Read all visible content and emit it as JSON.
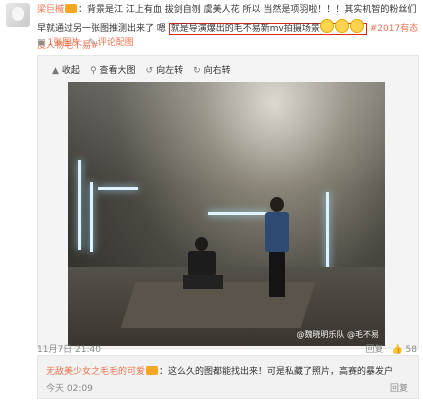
{
  "post": {
    "author": "梁巨槭",
    "text_part1": "：背景是江 江上有血 拔剑自刎 虞美人花 所以 当然是项羽啦！！！其实机智的粉丝们早就通过另一张图推测出来了 嗯",
    "text_boxed": "就是导演爆出的毛不易新mv拍摄场景",
    "topic": "#2017有态度人物毛不易#",
    "links": [
      {
        "icon": "image-icon",
        "label": "1张图片"
      },
      {
        "icon": "comment-icon",
        "label": "评论配图"
      }
    ]
  },
  "viewer": {
    "toolbar": [
      {
        "icon": "collapse-icon",
        "label": "收起"
      },
      {
        "icon": "zoom-icon",
        "label": "查看大图"
      },
      {
        "icon": "rotate-left-icon",
        "label": "向左转"
      },
      {
        "icon": "rotate-right-icon",
        "label": "向右转"
      }
    ],
    "watermark": "@魏晓明乐队 @毛不易"
  },
  "meta": {
    "time": "11月7日 21:40",
    "reply": "回复",
    "likes": "58"
  },
  "comment": {
    "user": "无敌美少女之毛毛的可爱",
    "text": "：这么久的图都能找出来！可是私藏了照片，高赛的暴发户",
    "time": "今天 02:09",
    "reply": "回复"
  },
  "colors": {
    "link": "#eb7350",
    "highlight_box": "#e0251b"
  }
}
